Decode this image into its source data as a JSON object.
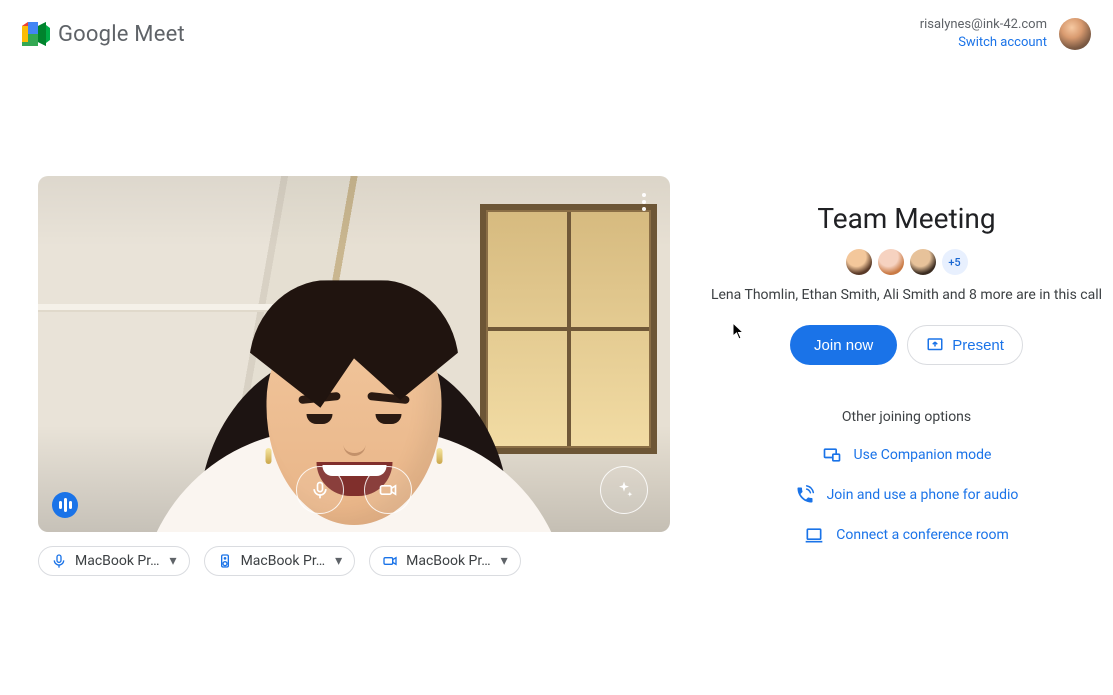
{
  "brand": {
    "name": "Google Meet"
  },
  "account": {
    "email": "risalynes@ink-42.com",
    "switch_label": "Switch account"
  },
  "devices": {
    "mic": {
      "label": "MacBook Pr…",
      "icon": "mic-icon"
    },
    "speaker": {
      "label": "MacBook Pr…",
      "icon": "speaker-icon"
    },
    "camera": {
      "label": "MacBook Pr…",
      "icon": "camera-icon"
    }
  },
  "meeting": {
    "title": "Team Meeting",
    "participant_overflow": "+5",
    "participants_line": "Lena Thomlin, Ethan Smith, Ali Smith and 8 more are in this call",
    "join_label": "Join now",
    "present_label": "Present"
  },
  "other_options": {
    "heading": "Other joining options",
    "companion": "Use Companion mode",
    "phone": "Join and use a phone for audio",
    "room": "Connect a conference room"
  }
}
